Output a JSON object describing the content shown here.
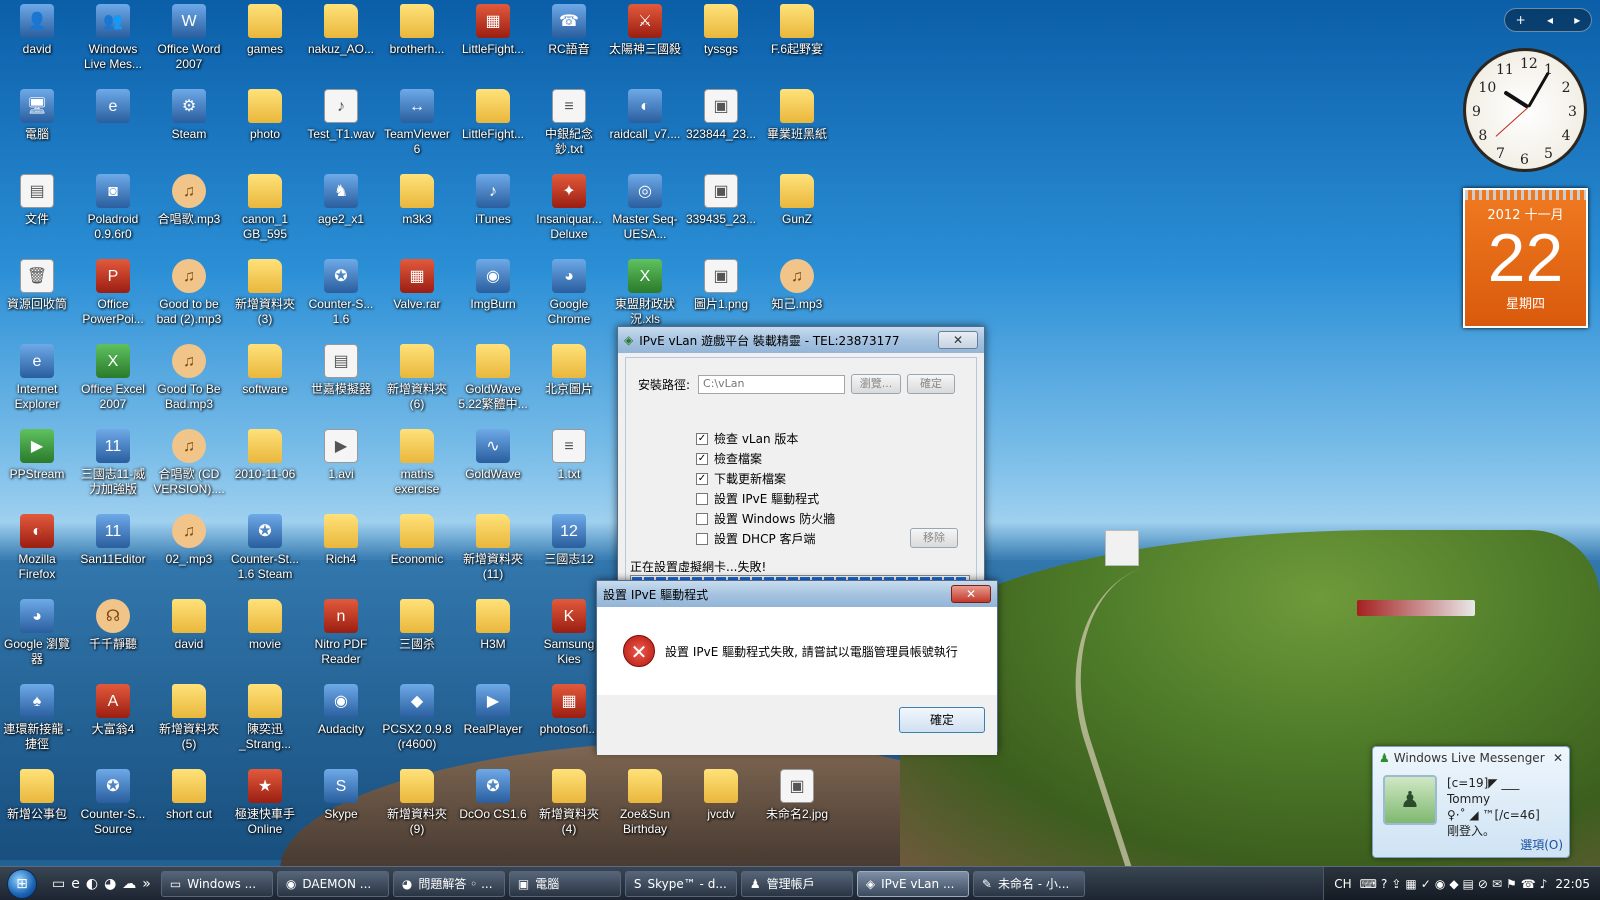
{
  "desktop": {
    "icons": [
      {
        "label": "david",
        "type": "app",
        "glyph": "👤"
      },
      {
        "label": "Windows Live Mes...",
        "type": "app",
        "glyph": "👥"
      },
      {
        "label": "Office Word 2007",
        "type": "app",
        "glyph": "W"
      },
      {
        "label": "games",
        "type": "folder",
        "glyph": ""
      },
      {
        "label": "nakuz_AO...",
        "type": "folder",
        "glyph": ""
      },
      {
        "label": "brotherh...",
        "type": "folder",
        "glyph": ""
      },
      {
        "label": "LittleFight...",
        "type": "red",
        "glyph": "▦"
      },
      {
        "label": "RC語音",
        "type": "app",
        "glyph": "☎"
      },
      {
        "label": "太陽神三國殺",
        "type": "red",
        "glyph": "⚔"
      },
      {
        "label": "tyssgs",
        "type": "folder",
        "glyph": ""
      },
      {
        "label": "F.6起野宴",
        "type": "folder",
        "glyph": ""
      },
      {
        "label": "電腦",
        "type": "app",
        "glyph": "🖥"
      },
      {
        "label": "",
        "type": "app",
        "glyph": "e"
      },
      {
        "label": "Steam",
        "type": "app",
        "glyph": "⚙"
      },
      {
        "label": "photo",
        "type": "folder",
        "glyph": ""
      },
      {
        "label": "Test_T1.wav",
        "type": "doc",
        "glyph": "♪"
      },
      {
        "label": "TeamViewer 6",
        "type": "app",
        "glyph": "↔"
      },
      {
        "label": "LittleFight...",
        "type": "folder",
        "glyph": ""
      },
      {
        "label": "中銀紀念鈔.txt",
        "type": "doc",
        "glyph": "≡"
      },
      {
        "label": "raidcall_v7....",
        "type": "app",
        "glyph": "◐"
      },
      {
        "label": "323844_23...",
        "type": "doc",
        "glyph": "▣"
      },
      {
        "label": "畢業班黑紙",
        "type": "folder",
        "glyph": ""
      },
      {
        "label": "文件",
        "type": "doc",
        "glyph": "▤"
      },
      {
        "label": "Poladroid 0.9.6r0",
        "type": "app",
        "glyph": "◙"
      },
      {
        "label": "合唱歌.mp3",
        "type": "media",
        "glyph": "♫"
      },
      {
        "label": "canon_1 GB_595",
        "type": "folder",
        "glyph": ""
      },
      {
        "label": "age2_x1",
        "type": "app",
        "glyph": "♞"
      },
      {
        "label": "m3k3",
        "type": "folder",
        "glyph": ""
      },
      {
        "label": "iTunes",
        "type": "app",
        "glyph": "♪"
      },
      {
        "label": "Insaniquar... Deluxe",
        "type": "red",
        "glyph": "✦"
      },
      {
        "label": "Master Seq-UESA...",
        "type": "app",
        "glyph": "◎"
      },
      {
        "label": "339435_23...",
        "type": "doc",
        "glyph": "▣"
      },
      {
        "label": "GunZ",
        "type": "folder",
        "glyph": ""
      },
      {
        "label": "資源回收筒",
        "type": "doc",
        "glyph": "🗑"
      },
      {
        "label": "Office PowerPoi...",
        "type": "red",
        "glyph": "P"
      },
      {
        "label": "Good to be bad (2).mp3",
        "type": "media",
        "glyph": "♫"
      },
      {
        "label": "新增資料夾 (3)",
        "type": "folder",
        "glyph": ""
      },
      {
        "label": "Counter-S... 1.6",
        "type": "app",
        "glyph": "✪"
      },
      {
        "label": "Valve.rar",
        "type": "red",
        "glyph": "▦"
      },
      {
        "label": "ImgBurn",
        "type": "app",
        "glyph": "◉"
      },
      {
        "label": "Google Chrome",
        "type": "app",
        "glyph": "◕"
      },
      {
        "label": "東盟財政狀況.xls",
        "type": "green",
        "glyph": "X"
      },
      {
        "label": "圖片1.png",
        "type": "doc",
        "glyph": "▣"
      },
      {
        "label": "知己.mp3",
        "type": "media",
        "glyph": "♫"
      },
      {
        "label": "Internet Explorer",
        "type": "app",
        "glyph": "e"
      },
      {
        "label": "Office Excel 2007",
        "type": "green",
        "glyph": "X"
      },
      {
        "label": "Good To Be Bad.mp3",
        "type": "media",
        "glyph": "♫"
      },
      {
        "label": "software",
        "type": "folder",
        "glyph": ""
      },
      {
        "label": "世嘉模擬器",
        "type": "doc",
        "glyph": "▤"
      },
      {
        "label": "新增資料夾 (6)",
        "type": "folder",
        "glyph": ""
      },
      {
        "label": "GoldWave 5.22繁體中...",
        "type": "folder",
        "glyph": ""
      },
      {
        "label": "北京圖片",
        "type": "folder",
        "glyph": ""
      },
      {
        "label": "PPStream",
        "type": "green",
        "glyph": "▶"
      },
      {
        "label": "三國志11-威力加強版",
        "type": "app",
        "glyph": "11"
      },
      {
        "label": "合唱歌 (CD VERSION)....",
        "type": "media",
        "glyph": "♫"
      },
      {
        "label": "2010-11-06",
        "type": "folder",
        "glyph": ""
      },
      {
        "label": "1.avi",
        "type": "doc",
        "glyph": "▶"
      },
      {
        "label": "maths exercise",
        "type": "folder",
        "glyph": ""
      },
      {
        "label": "GoldWave",
        "type": "app",
        "glyph": "∿"
      },
      {
        "label": "1.txt",
        "type": "doc",
        "glyph": "≡"
      },
      {
        "label": "Mozilla Firefox",
        "type": "red",
        "glyph": "◐"
      },
      {
        "label": "San11Editor",
        "type": "app",
        "glyph": "11"
      },
      {
        "label": "02_.mp3",
        "type": "media",
        "glyph": "♫"
      },
      {
        "label": "Counter-St... 1.6 Steam",
        "type": "app",
        "glyph": "✪"
      },
      {
        "label": "Rich4",
        "type": "folder",
        "glyph": ""
      },
      {
        "label": "Economic",
        "type": "folder",
        "glyph": ""
      },
      {
        "label": "新增資料夾 (11)",
        "type": "folder",
        "glyph": ""
      },
      {
        "label": "三國志12",
        "type": "app",
        "glyph": "12"
      },
      {
        "label": "Google 瀏覽器",
        "type": "app",
        "glyph": "◕"
      },
      {
        "label": "千千靜聽",
        "type": "media",
        "glyph": "☊"
      },
      {
        "label": "david",
        "type": "folder",
        "glyph": ""
      },
      {
        "label": "movie",
        "type": "folder",
        "glyph": ""
      },
      {
        "label": "Nitro PDF Reader",
        "type": "red",
        "glyph": "n"
      },
      {
        "label": "三國杀",
        "type": "folder",
        "glyph": ""
      },
      {
        "label": "H3M",
        "type": "folder",
        "glyph": ""
      },
      {
        "label": "Samsung Kies",
        "type": "red",
        "glyph": "K"
      },
      {
        "label": "連環新接龍 - 捷徑",
        "type": "app",
        "glyph": "♠"
      },
      {
        "label": "大富翁4",
        "type": "red",
        "glyph": "A"
      },
      {
        "label": "新增資料夾 (5)",
        "type": "folder",
        "glyph": ""
      },
      {
        "label": "陳奕迅_Strang...",
        "type": "folder",
        "glyph": ""
      },
      {
        "label": "Audacity",
        "type": "app",
        "glyph": "◉"
      },
      {
        "label": "PCSX2 0.9.8 (r4600)",
        "type": "app",
        "glyph": "◆"
      },
      {
        "label": "RealPlayer",
        "type": "app",
        "glyph": "▶"
      },
      {
        "label": "photosofi...",
        "type": "red",
        "glyph": "▦"
      },
      {
        "label": "新增公事包",
        "type": "folder",
        "glyph": ""
      },
      {
        "label": "Counter-S... Source",
        "type": "app",
        "glyph": "✪"
      },
      {
        "label": "short cut",
        "type": "folder",
        "glyph": ""
      },
      {
        "label": "極速快車手 Online",
        "type": "red",
        "glyph": "★"
      },
      {
        "label": "Skype",
        "type": "app",
        "glyph": "S"
      },
      {
        "label": "新增資料夾 (9)",
        "type": "folder",
        "glyph": ""
      },
      {
        "label": "DcOo CS1.6",
        "type": "app",
        "glyph": "✪"
      },
      {
        "label": "新增資料夾 (4)",
        "type": "folder",
        "glyph": ""
      },
      {
        "label": "Zoe&Sun Birthday",
        "type": "folder",
        "glyph": ""
      },
      {
        "label": "jvcdv",
        "type": "folder",
        "glyph": ""
      },
      {
        "label": "未命名2.jpg",
        "type": "doc",
        "glyph": "▣"
      }
    ]
  },
  "gadgets": {
    "clock": {
      "numbers": [
        "12",
        "1",
        "2",
        "3",
        "4",
        "5",
        "6",
        "7",
        "8",
        "9",
        "10",
        "11"
      ],
      "hour": 10,
      "minute": 5,
      "second": 38
    },
    "calendar": {
      "header": "2012 十一月",
      "day": "22",
      "weekday": "星期四"
    },
    "toolbar": {
      "add": "+",
      "prev": "◂",
      "next": "▸"
    }
  },
  "installer": {
    "title": "IPvE vLan 遊戲平台 裝載精靈 - TEL:23873177",
    "close": "✕",
    "path_label": "安裝路徑:",
    "path_value": "C:\\vLan",
    "browse": "瀏覽...",
    "confirm": "確定",
    "options": [
      {
        "label": "檢查 vLan 版本",
        "checked": true
      },
      {
        "label": "檢查檔案",
        "checked": true
      },
      {
        "label": "下載更新檔案",
        "checked": true
      },
      {
        "label": "設置 IPvE 驅動程式",
        "checked": false
      },
      {
        "label": "設置 Windows 防火牆",
        "checked": false
      },
      {
        "label": "設置 DHCP 客戶端",
        "checked": false
      }
    ],
    "remove": "移除",
    "status": "正在設置虛擬網卡...失敗!",
    "progress": 100
  },
  "error_dialog": {
    "title": "設置 IPvE 驅動程式",
    "close": "✕",
    "icon": "✕",
    "message": "設置 IPvE 驅動程式失敗, 請嘗試以電腦管理員帳號執行",
    "ok": "確定"
  },
  "messenger_toast": {
    "app": "Windows Live Messenger",
    "close": "✕",
    "message_line1": "[c=19]◤ ___ Tommy",
    "message_line2": "♀·˚ ◢ ™[/c=46]",
    "message_line3": "剛登入。",
    "options": "選項(O)"
  },
  "taskbar": {
    "start": "⊞",
    "quicklaunch": [
      "▭",
      "e",
      "◐",
      "◕",
      "☁",
      "»"
    ],
    "tasks": [
      {
        "label": "Windows ...",
        "icon": "▭",
        "active": false
      },
      {
        "label": "DAEMON ...",
        "icon": "◉",
        "active": false
      },
      {
        "label": "問題解答 ◦ ...",
        "icon": "◕",
        "active": false
      },
      {
        "label": "電腦",
        "icon": "▣",
        "active": false
      },
      {
        "label": "Skype™ - d...",
        "icon": "S",
        "active": false
      },
      {
        "label": "管理帳戶",
        "icon": "♟",
        "active": false
      },
      {
        "label": "IPvE vLan ...",
        "icon": "◈",
        "active": true
      },
      {
        "label": "未命名 - 小...",
        "icon": "✎",
        "active": false
      }
    ],
    "tray": {
      "lang": "CH",
      "time": "22:05",
      "icons": [
        "⌨",
        "?",
        "⇪",
        "▦",
        "✓",
        "◉",
        "◆",
        "▤",
        "⊘",
        "✉",
        "⚑",
        "☎",
        "♪"
      ]
    }
  },
  "colors": {
    "calendar_orange": "#e8650f",
    "progress_blue": "#1e72e8",
    "error_red": "#c0281c"
  }
}
